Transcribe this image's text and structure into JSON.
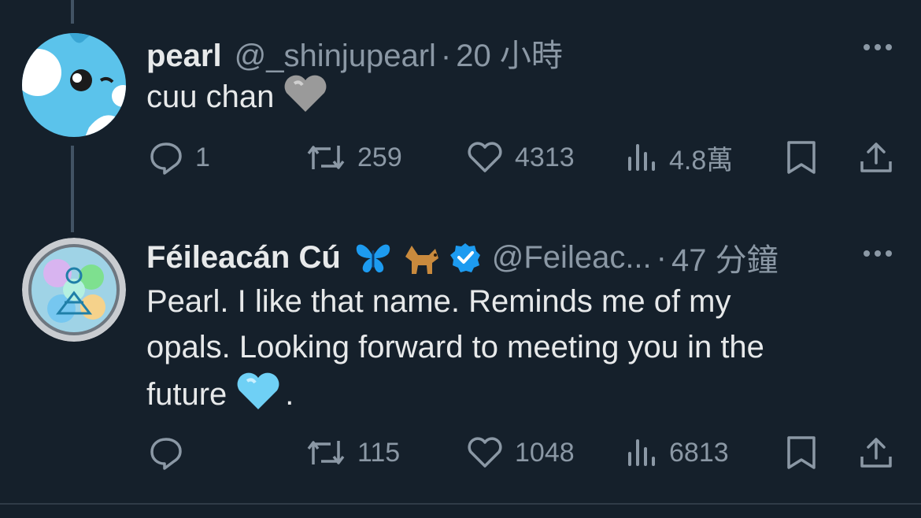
{
  "tweets": [
    {
      "display_name": "pearl",
      "handle": "@_shinjupearl",
      "separator": "·",
      "time": "20 小時",
      "text": "cuu chan",
      "text_emoji": "grey-heart",
      "stats": {
        "replies": "1",
        "retweets": "259",
        "likes": "4313",
        "views": "4.8萬"
      }
    },
    {
      "display_name": "Féileacán Cú",
      "name_emojis": [
        "butterfly",
        "dog"
      ],
      "verified": true,
      "handle": "@Feileac...",
      "separator": "·",
      "time": "47 分鐘",
      "text_lines": [
        "Pearl. I like that name. Reminds me of my",
        "opals. Looking forward to meeting you in the",
        "future"
      ],
      "text_suffix": ".",
      "text_emoji": "light-blue-heart",
      "stats": {
        "replies": "",
        "retweets": "115",
        "likes": "1048",
        "views": "6813"
      }
    }
  ],
  "colors": {
    "background": "#15202b",
    "text": "#e7e9ea",
    "muted": "#8b98a5",
    "verified": "#1d9bf0",
    "thread_line": "#425364"
  }
}
